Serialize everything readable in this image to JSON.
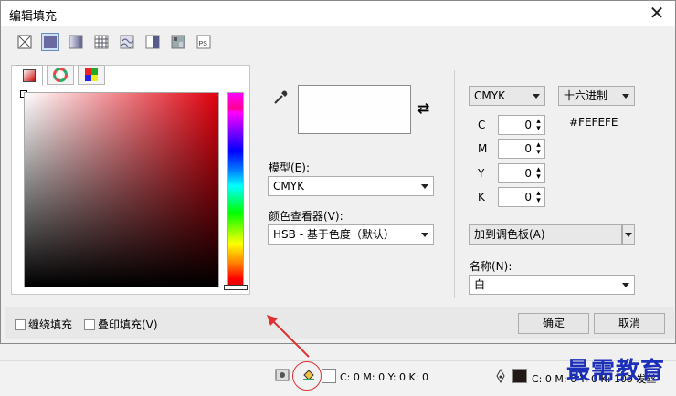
{
  "dialog": {
    "title": "编辑填充",
    "close_glyph": "✕"
  },
  "fill_types": [
    "no-fill",
    "uniform-fill",
    "fountain-fill",
    "pattern-fill",
    "texture-fill",
    "two-color-fill",
    "bitmap-fill",
    "postscript-fill"
  ],
  "color_tabs": [
    "color-viewers",
    "color-harmonies",
    "color-palettes"
  ],
  "color": {
    "hex": "#FEFEFE",
    "selected_hue_color": "#E0000D"
  },
  "model": {
    "label": "模型(E):",
    "value": "CMYK"
  },
  "viewer": {
    "label": "颜色查看器(V):",
    "value": "HSB - 基于色度（默认）"
  },
  "right": {
    "model_select": "CMYK",
    "format_select": "十六进制",
    "hex": "#FEFEFE",
    "channels": [
      {
        "label": "C",
        "value": "0"
      },
      {
        "label": "M",
        "value": "0"
      },
      {
        "label": "Y",
        "value": "0"
      },
      {
        "label": "K",
        "value": "0"
      }
    ],
    "add_to_palette": "加到调色板(A)",
    "name_label": "名称(N):",
    "name_value": "白"
  },
  "footer": {
    "wrap_fill": "缠绕填充",
    "overprint_fill": "叠印填充(V)",
    "ok": "确定",
    "cancel": "取消"
  },
  "statusbar": {
    "fill_readout": "C: 0 M: 0 Y: 0 K: 0",
    "outline_readout": "C: 0 M: 0 Y: 0 K: 100 发丝"
  },
  "watermark": "最需教育"
}
